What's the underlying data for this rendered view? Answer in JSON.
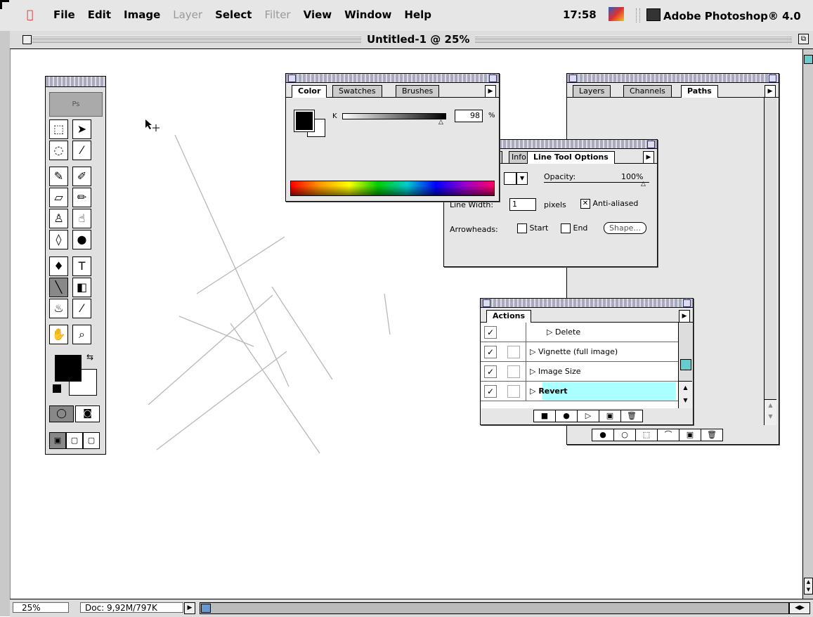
{
  "menubar": {
    "items": [
      {
        "label": "File",
        "enabled": true
      },
      {
        "label": "Edit",
        "enabled": true
      },
      {
        "label": "Image",
        "enabled": true
      },
      {
        "label": "Layer",
        "enabled": false
      },
      {
        "label": "Select",
        "enabled": true
      },
      {
        "label": "Filter",
        "enabled": false
      },
      {
        "label": "View",
        "enabled": true
      },
      {
        "label": "Window",
        "enabled": true
      },
      {
        "label": "Help",
        "enabled": true
      }
    ],
    "clock": "17:58",
    "app_name": "Adobe Photoshop® 4.0"
  },
  "document": {
    "title": "Untitled-1 @ 25%",
    "zoom": "25%",
    "doc_size": "Doc: 9,92M/797K"
  },
  "color_panel": {
    "tabs": [
      "Color",
      "Swatches",
      "Brushes"
    ],
    "active_tab": "Color",
    "channel_label": "K",
    "channel_value": "98",
    "unit": "%"
  },
  "layers_panel": {
    "tabs": [
      "Layers",
      "Channels",
      "Paths"
    ],
    "active_tab": "Paths"
  },
  "line_tool_panel": {
    "tabs": [
      "r",
      "Info",
      "Line Tool Options"
    ],
    "active_tab": "Line Tool Options",
    "opacity_label": "Opacity:",
    "opacity_value": "100%",
    "line_width_label": "Line Width:",
    "line_width_value": "1",
    "line_width_unit": "pixels",
    "anti_aliased_label": "Anti-aliased",
    "anti_aliased": true,
    "arrowheads_label": "Arrowheads:",
    "start_label": "Start",
    "end_label": "End",
    "shape_button": "Shape..."
  },
  "actions_panel": {
    "tab": "Actions",
    "rows": [
      {
        "label": "Delete",
        "checked": true,
        "highlighted": false
      },
      {
        "label": "Vignette (full image)",
        "checked": true,
        "highlighted": false
      },
      {
        "label": "Image Size",
        "checked": true,
        "highlighted": false
      },
      {
        "label": "Revert",
        "checked": true,
        "highlighted": true
      }
    ]
  },
  "icons": {
    "apple": "apple-menu-icon",
    "check": "✓",
    "triangle": "▷",
    "menu_arrow": "▶"
  }
}
